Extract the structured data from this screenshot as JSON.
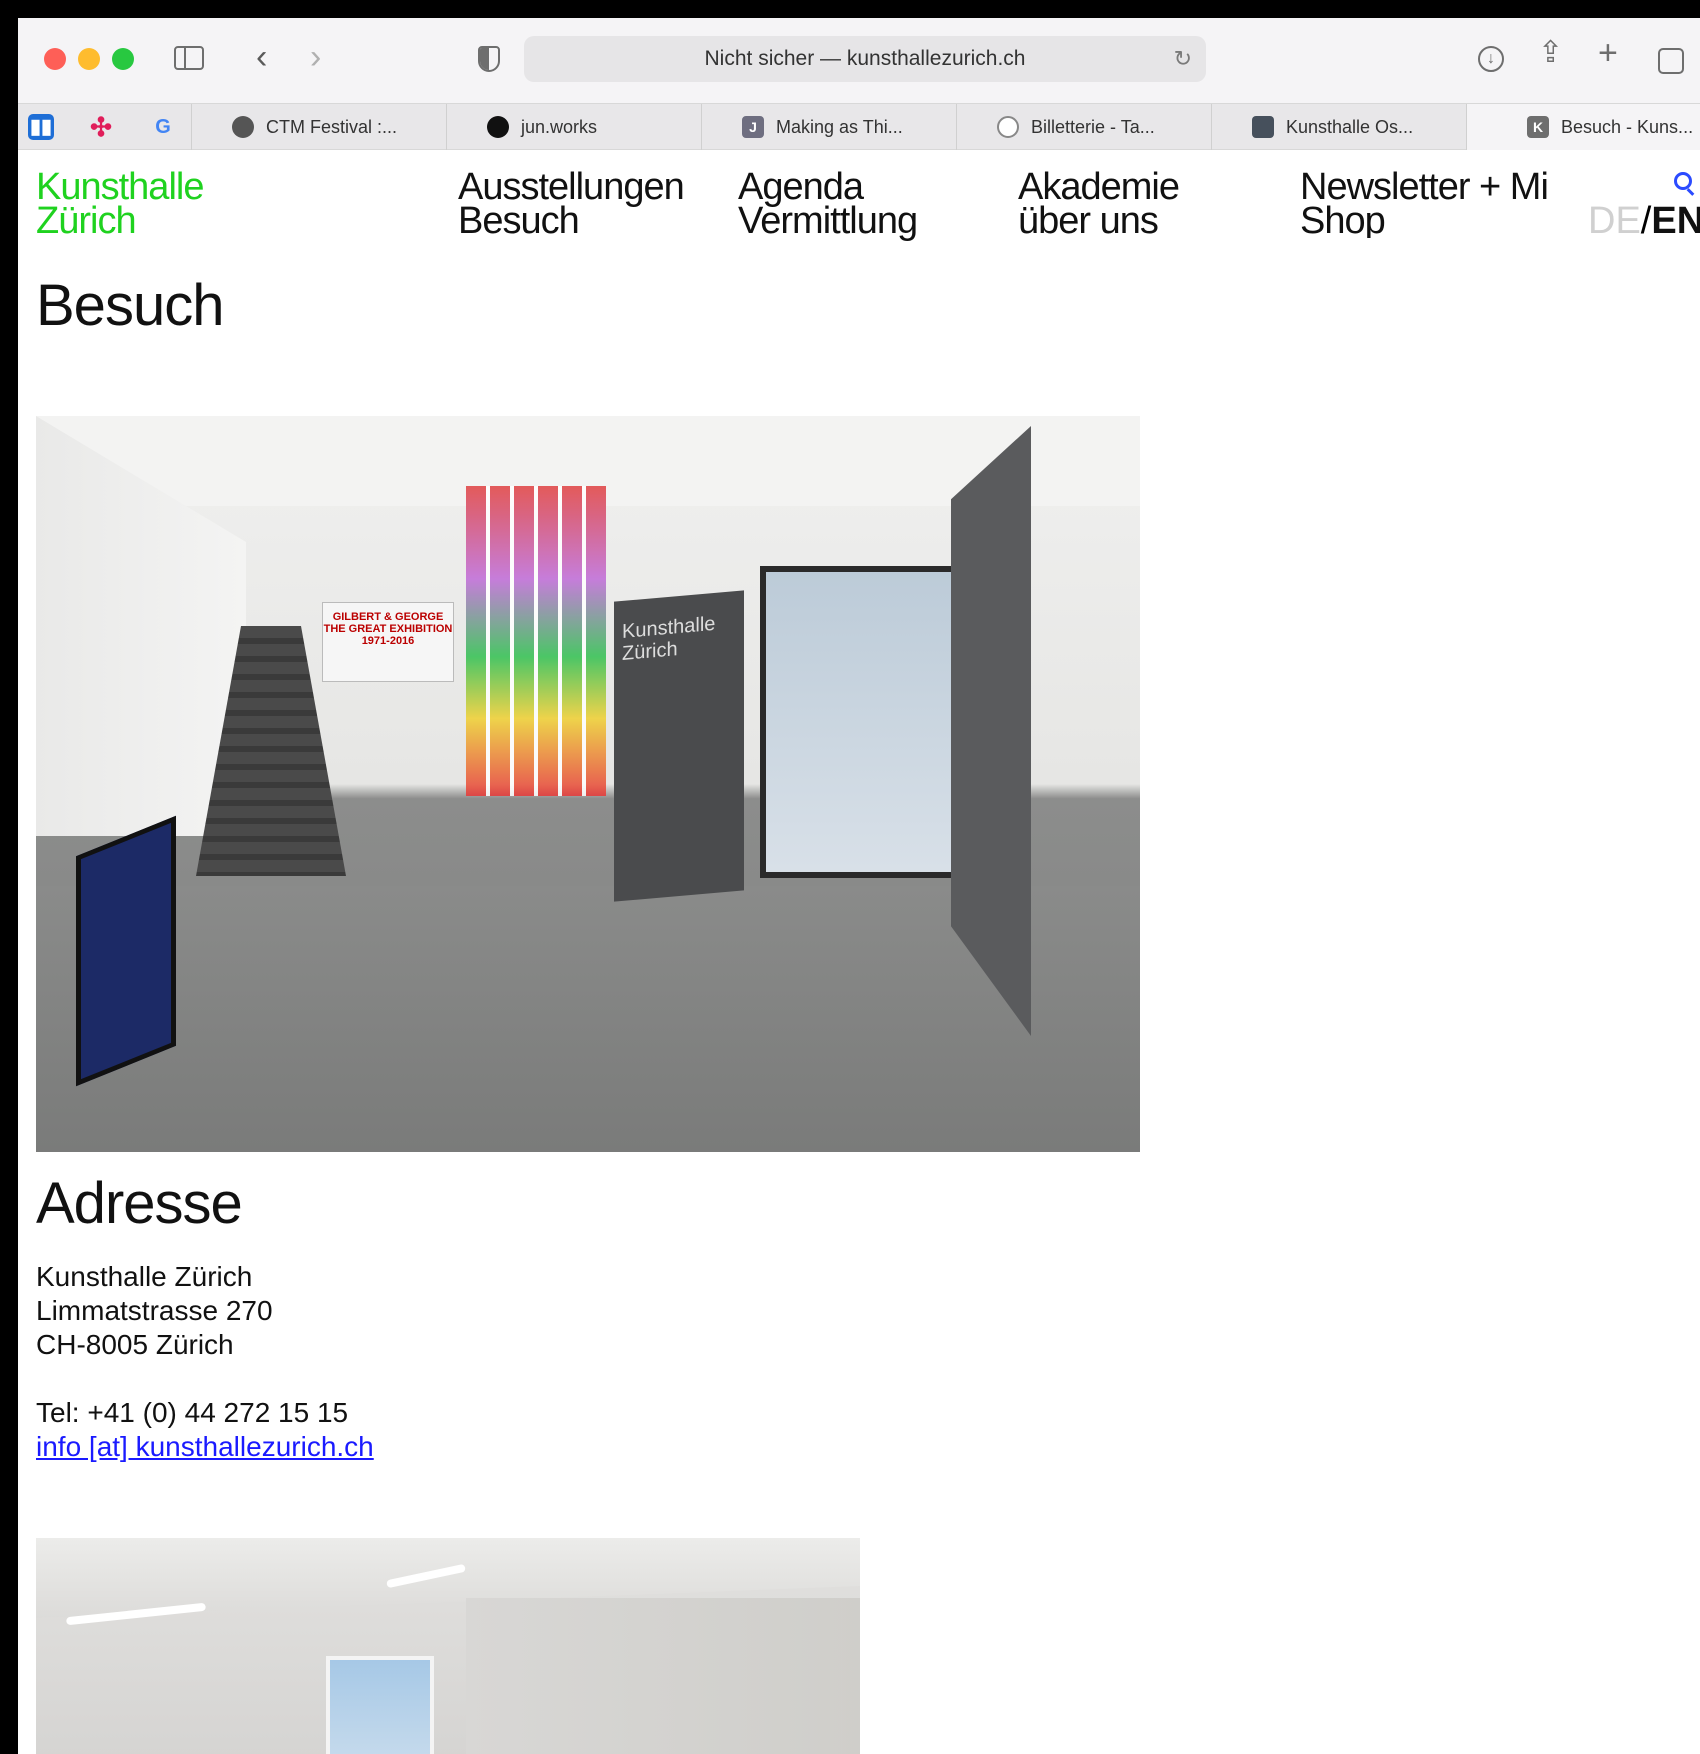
{
  "browser": {
    "url_text": "Nicht sicher — kunsthallezurich.ch",
    "tabs": [
      {
        "label": "CTM Festival :...",
        "favicon": "globe-icon"
      },
      {
        "label": "jun.works",
        "favicon": "jun-icon"
      },
      {
        "label": "Making as Thi...",
        "favicon": "J"
      },
      {
        "label": "Billetterie - Ta...",
        "favicon": "spiral-icon"
      },
      {
        "label": "Kunsthalle Os...",
        "favicon": "image-icon"
      },
      {
        "label": "Besuch - Kuns...",
        "favicon": "K",
        "active": true
      }
    ],
    "pinned_tabs": [
      "trello-icon",
      "slack-icon",
      "google-icon"
    ],
    "pinned_google_letter": "G",
    "pinned_trello_letter": "▮▮"
  },
  "site": {
    "logo_line1": "Kunsthalle",
    "logo_line2": "Zürich",
    "logo_color": "#1fd21f",
    "nav": [
      {
        "top": "Ausstellungen",
        "bottom": "Besuch"
      },
      {
        "top": "Agenda",
        "bottom": "Vermittlung"
      },
      {
        "top": "Akademie",
        "bottom": "über uns"
      },
      {
        "top": "Newsletter + Mi",
        "bottom": "Shop"
      }
    ],
    "lang_de": "DE",
    "lang_sep": "/",
    "lang_en": "EN"
  },
  "page": {
    "title": "Besuch",
    "photo1_sign_text": "GILBERT & GEORGE THE GREAT EXHIBITION 1971-2016",
    "photo1_door_text": "Kunsthalle Zürich",
    "address_heading": "Adresse",
    "address_lines": [
      "Kunsthalle Zürich",
      "Limmatstrasse 270",
      "CH-8005 Zürich"
    ],
    "tel": "Tel: +41 (0) 44 272 15 15",
    "email": "info [at] kunsthallezurich.ch"
  }
}
